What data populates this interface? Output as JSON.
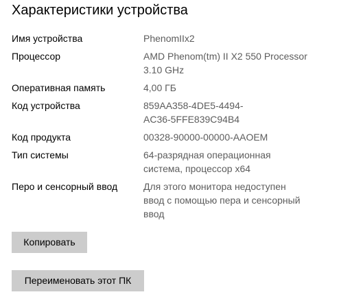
{
  "section": {
    "title": "Характеристики устройства"
  },
  "specs": [
    {
      "label": "Имя устройства",
      "value": "PhenomIIx2"
    },
    {
      "label": "Процессор",
      "value": "AMD Phenom(tm) II X2 550 Processor\n3.10 GHz"
    },
    {
      "label": "Оперативная память",
      "value": "4,00 ГБ"
    },
    {
      "label": "Код устройства",
      "value": "859AA358-4DE5-4494-\nAC36-5FFE839C94B4"
    },
    {
      "label": "Код продукта",
      "value": "00328-90000-00000-AAOEM"
    },
    {
      "label": "Тип системы",
      "value": "64-разрядная операционная\nсистема, процессор x64"
    },
    {
      "label": "Перо и сенсорный ввод",
      "value": "Для этого монитора недоступен\nввод с помощью пера и сенсорный\nввод"
    }
  ],
  "buttons": {
    "copy_label": "Копировать",
    "rename_label": "Переименовать этот ПК"
  },
  "colors": {
    "value_text": "#5c5c5c",
    "button_bg": "#cccccc"
  }
}
